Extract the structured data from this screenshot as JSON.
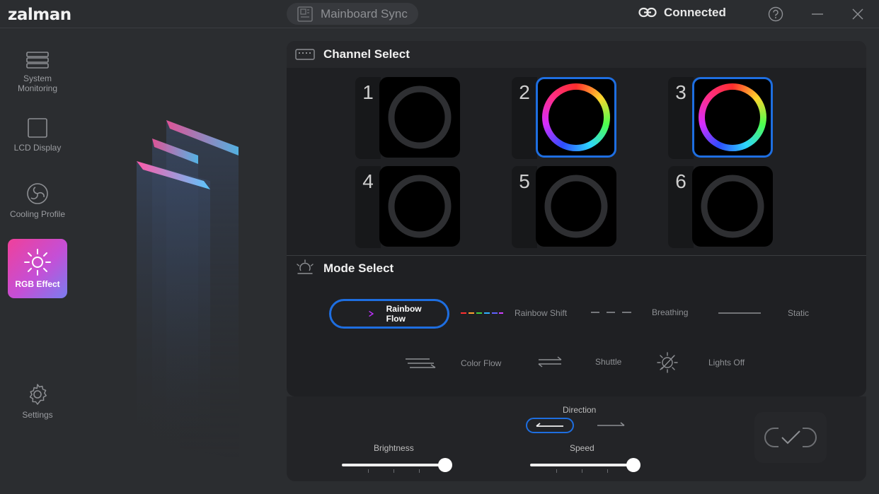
{
  "app": {
    "logo": "zalman"
  },
  "titlebar": {
    "mainboard_sync": "Mainboard Sync",
    "connection_status": "Connected"
  },
  "sidebar": {
    "items": [
      {
        "label": "System Monitoring",
        "icon": "server-icon"
      },
      {
        "label": "LCD Display",
        "icon": "square-icon"
      },
      {
        "label": "Cooling Profile",
        "icon": "fan-icon"
      },
      {
        "label": "RGB Effect",
        "icon": "sun-icon",
        "active": true
      },
      {
        "label": "Settings",
        "icon": "gear-icon"
      }
    ]
  },
  "channel_select": {
    "title": "Channel Select",
    "channels": [
      {
        "num": "1",
        "selected": false
      },
      {
        "num": "2",
        "selected": true
      },
      {
        "num": "3",
        "selected": true
      },
      {
        "num": "4",
        "selected": false
      },
      {
        "num": "5",
        "selected": false
      },
      {
        "num": "6",
        "selected": false
      }
    ]
  },
  "mode_select": {
    "title": "Mode Select",
    "modes": [
      {
        "label": "Rainbow Flow",
        "selected": true
      },
      {
        "label": "Rainbow Shift"
      },
      {
        "label": "Breathing"
      },
      {
        "label": "Static"
      },
      {
        "label": "Color Flow"
      },
      {
        "label": "Shuttle"
      },
      {
        "label": "Lights Off"
      }
    ]
  },
  "controls": {
    "direction_label": "Direction",
    "direction_selected": "left",
    "brightness_label": "Brightness",
    "brightness_value": 100,
    "speed_label": "Speed",
    "speed_value": 100
  },
  "colors": {
    "accent": "#1e6ee0",
    "active_gradient_start": "#f0409a",
    "active_gradient_end": "#7a7df0"
  }
}
